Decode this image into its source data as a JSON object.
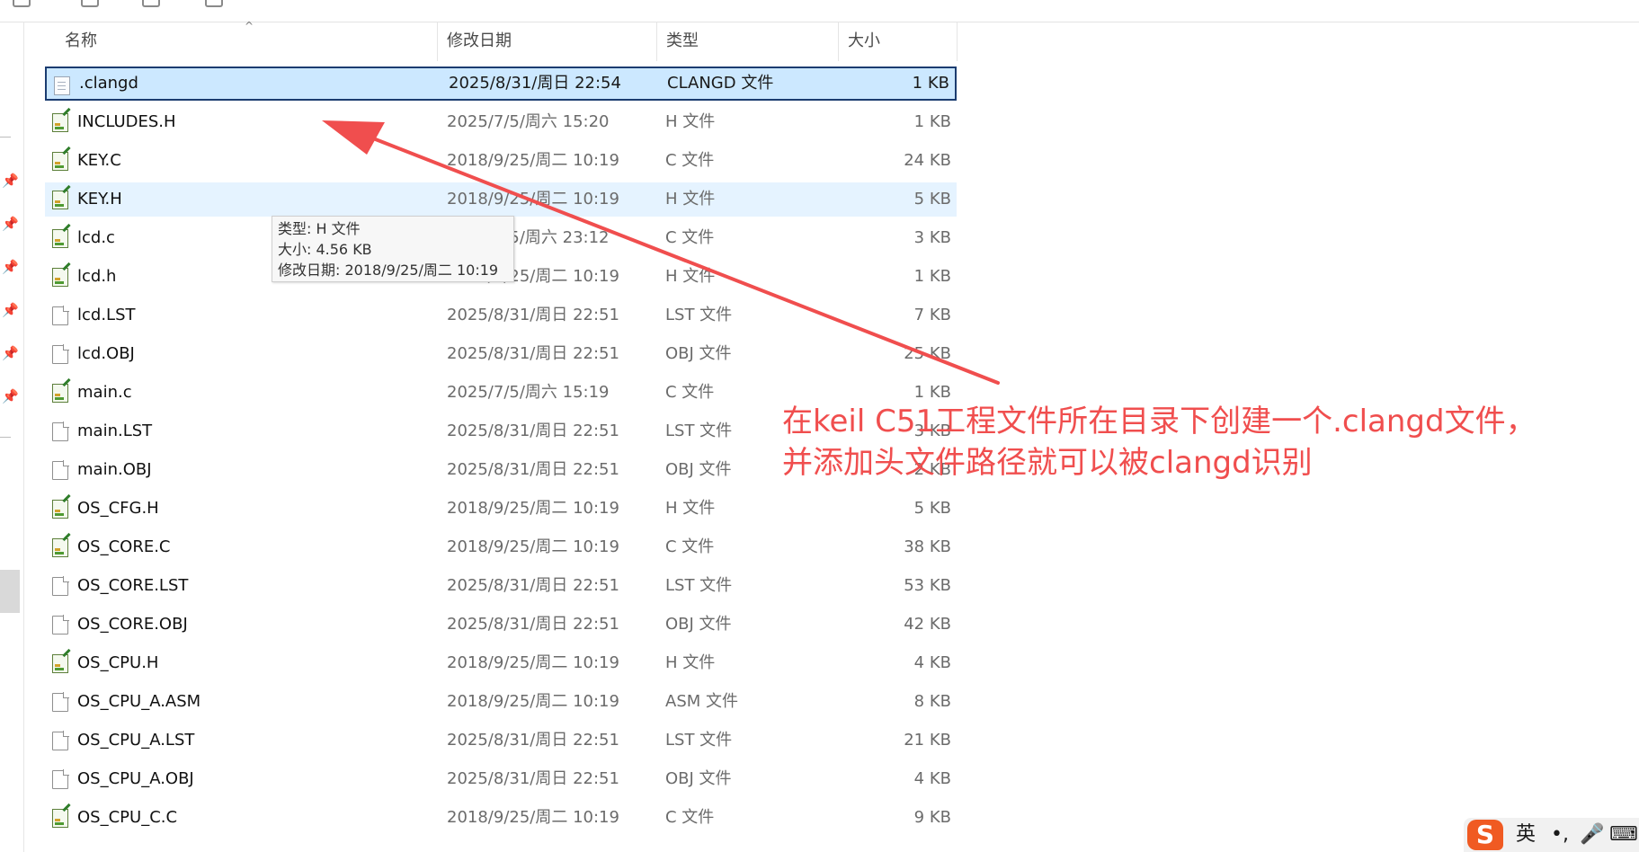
{
  "header": {
    "name": "名称",
    "date": "修改日期",
    "type": "类型",
    "size": "大小"
  },
  "files": [
    {
      "name": ".clangd",
      "date": "2025/8/31/周日 22:54",
      "type": "CLANGD 文件",
      "size": "1 KB",
      "icon": "clangd-file-icon",
      "state": "selected"
    },
    {
      "name": "INCLUDES.H",
      "date": "2025/7/5/周六 15:20",
      "type": "H 文件",
      "size": "1 KB",
      "icon": "source-file-icon",
      "state": ""
    },
    {
      "name": "KEY.C",
      "date": "2018/9/25/周二 10:19",
      "type": "C 文件",
      "size": "24 KB",
      "icon": "source-file-icon",
      "state": ""
    },
    {
      "name": "KEY.H",
      "date": "2018/9/25/周二 10:19",
      "type": "H 文件",
      "size": "5 KB",
      "icon": "source-file-icon",
      "state": "hover"
    },
    {
      "name": "lcd.c",
      "date": "2025/7/5/周六 23:12",
      "type": "C 文件",
      "size": "3 KB",
      "icon": "source-file-icon",
      "state": ""
    },
    {
      "name": "lcd.h",
      "date": "2018/9/25/周二 10:19",
      "type": "H 文件",
      "size": "1 KB",
      "icon": "source-file-icon",
      "state": ""
    },
    {
      "name": "lcd.LST",
      "date": "2025/8/31/周日 22:51",
      "type": "LST 文件",
      "size": "7 KB",
      "icon": "generic-file-icon",
      "state": ""
    },
    {
      "name": "lcd.OBJ",
      "date": "2025/8/31/周日 22:51",
      "type": "OBJ 文件",
      "size": "25 KB",
      "icon": "generic-file-icon",
      "state": ""
    },
    {
      "name": "main.c",
      "date": "2025/7/5/周六 15:19",
      "type": "C 文件",
      "size": "1 KB",
      "icon": "source-file-icon",
      "state": ""
    },
    {
      "name": "main.LST",
      "date": "2025/8/31/周日 22:51",
      "type": "LST 文件",
      "size": "3 KB",
      "icon": "generic-file-icon",
      "state": ""
    },
    {
      "name": "main.OBJ",
      "date": "2025/8/31/周日 22:51",
      "type": "OBJ 文件",
      "size": "2 KB",
      "icon": "generic-file-icon",
      "state": ""
    },
    {
      "name": "OS_CFG.H",
      "date": "2018/9/25/周二 10:19",
      "type": "H 文件",
      "size": "5 KB",
      "icon": "source-file-icon",
      "state": ""
    },
    {
      "name": "OS_CORE.C",
      "date": "2018/9/25/周二 10:19",
      "type": "C 文件",
      "size": "38 KB",
      "icon": "source-file-icon",
      "state": ""
    },
    {
      "name": "OS_CORE.LST",
      "date": "2025/8/31/周日 22:51",
      "type": "LST 文件",
      "size": "53 KB",
      "icon": "generic-file-icon",
      "state": ""
    },
    {
      "name": "OS_CORE.OBJ",
      "date": "2025/8/31/周日 22:51",
      "type": "OBJ 文件",
      "size": "42 KB",
      "icon": "generic-file-icon",
      "state": ""
    },
    {
      "name": "OS_CPU.H",
      "date": "2018/9/25/周二 10:19",
      "type": "H 文件",
      "size": "4 KB",
      "icon": "source-file-icon",
      "state": ""
    },
    {
      "name": "OS_CPU_A.ASM",
      "date": "2018/9/25/周二 10:19",
      "type": "ASM 文件",
      "size": "8 KB",
      "icon": "generic-file-icon",
      "state": ""
    },
    {
      "name": "OS_CPU_A.LST",
      "date": "2025/8/31/周日 22:51",
      "type": "LST 文件",
      "size": "21 KB",
      "icon": "generic-file-icon",
      "state": ""
    },
    {
      "name": "OS_CPU_A.OBJ",
      "date": "2025/8/31/周日 22:51",
      "type": "OBJ 文件",
      "size": "4 KB",
      "icon": "generic-file-icon",
      "state": ""
    },
    {
      "name": "OS_CPU_C.C",
      "date": "2018/9/25/周二 10:19",
      "type": "C 文件",
      "size": "9 KB",
      "icon": "source-file-icon",
      "state": ""
    }
  ],
  "tooltip": {
    "type": "类型: H 文件",
    "size": "大小: 4.56 KB",
    "date": "修改日期: 2018/9/25/周二 10:19"
  },
  "annotation": {
    "line1": "在keil C51工程文件所在目录下创建一个.clangd文件，",
    "line2": "并添加头文件路径就可以被clangd识别",
    "color": "#f04e4e"
  },
  "ime": {
    "logo": "S",
    "lang": "英",
    "punct": "•,",
    "mic": "🎤",
    "keyboard": "⌨"
  },
  "colors": {
    "selected_bg": "#cce8ff",
    "selected_border": "#1b3c70",
    "hover_bg": "#e5f3ff",
    "ime_logo": "#f05a22"
  }
}
